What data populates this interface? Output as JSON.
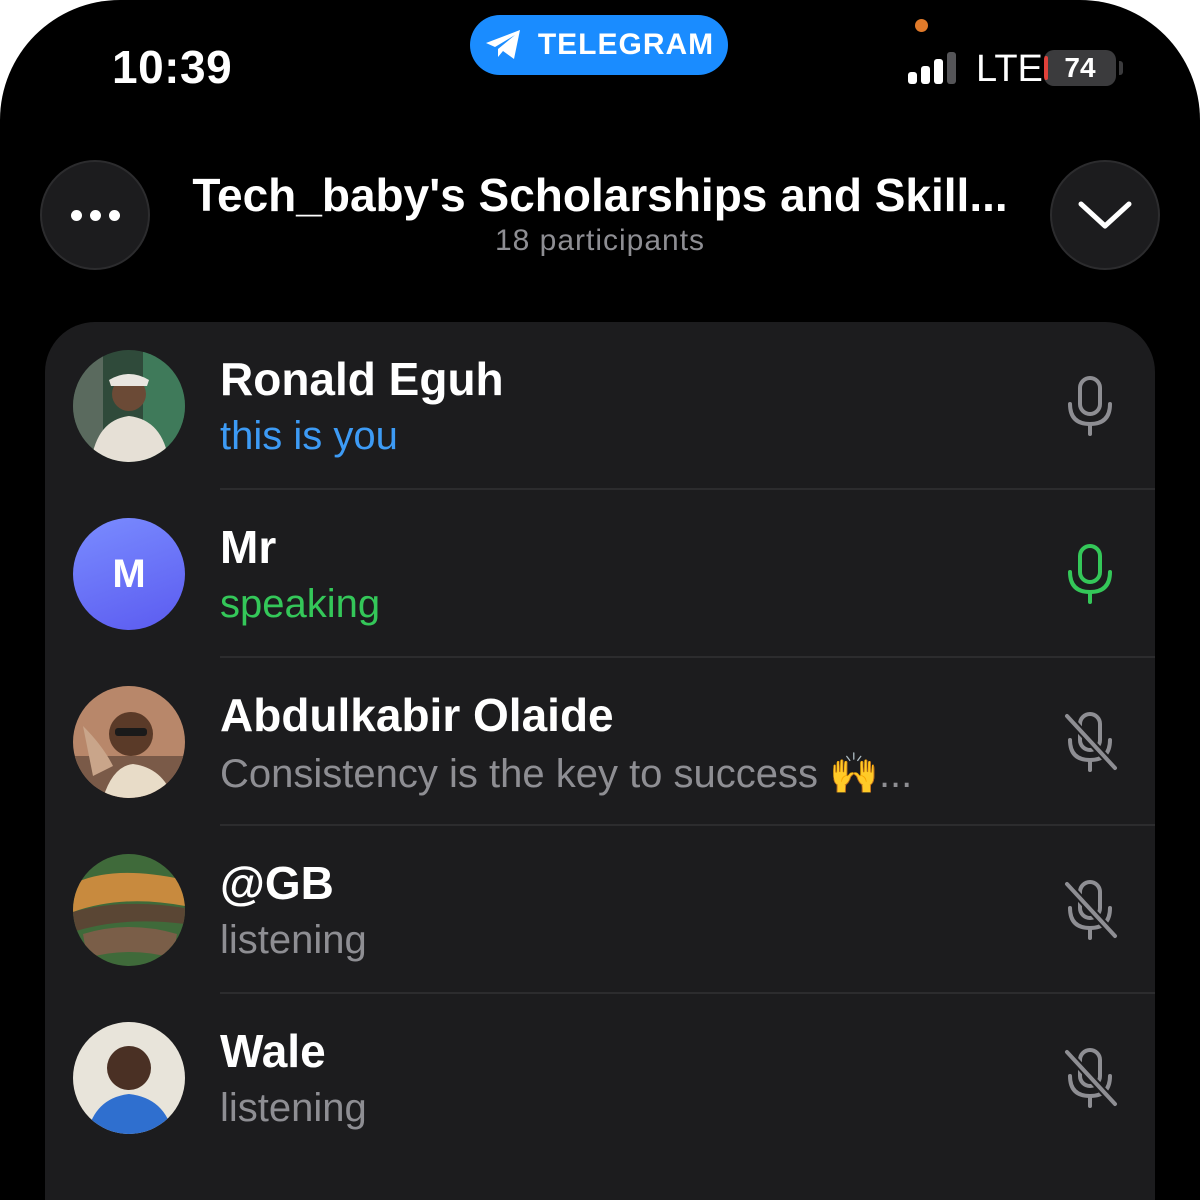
{
  "status_bar": {
    "time": "10:39",
    "app_pill_label": "TELEGRAM",
    "network": "LTE",
    "battery": "74",
    "battery_percent": 74
  },
  "header": {
    "title": "Tech_baby's Scholarships and Skill...",
    "participants": "18 participants"
  },
  "colors": {
    "accent_blue": "#1a8cff",
    "speaking_green": "#34c759",
    "muted_gray": "#8e8e93",
    "you_blue": "#3d9bf5"
  },
  "participants": [
    {
      "name": "Ronald Eguh",
      "status": "this is you",
      "mic": "mic-idle-icon"
    },
    {
      "name": "Mr",
      "status": "speaking",
      "initial": "M",
      "mic": "mic-active-icon"
    },
    {
      "name": "Abdulkabir Olaide",
      "status": "Consistency is the key to success 🙌...",
      "mic": "mic-muted-icon"
    },
    {
      "name": "@GB",
      "status": "listening",
      "mic": "mic-muted-icon"
    },
    {
      "name": "Wale",
      "status": "listening",
      "mic": "mic-muted-icon"
    }
  ]
}
